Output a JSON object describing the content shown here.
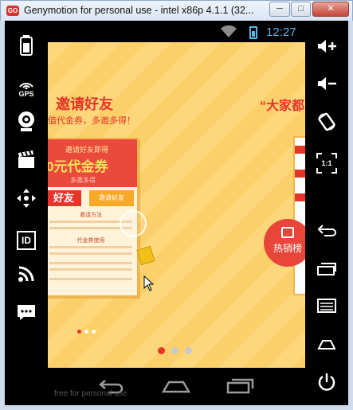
{
  "window": {
    "title": "Genymotion for personal use - intel x86p 4.1.1 (32...",
    "app_icon_text": "GO",
    "minimize_label": "─",
    "maximize_label": "□",
    "close_label": "✕"
  },
  "status_bar": {
    "time": "12:27",
    "accent_color": "#5ab7e6"
  },
  "left_panel": {
    "items": [
      {
        "icon": "battery-icon",
        "label": ""
      },
      {
        "icon": "gps-icon",
        "label": "GPS"
      },
      {
        "icon": "camera-icon",
        "label": ""
      },
      {
        "icon": "clapperboard-icon",
        "label": ""
      },
      {
        "icon": "dpad-icon",
        "label": ""
      },
      {
        "icon": "id-icon",
        "label": "ID"
      },
      {
        "icon": "rss-icon",
        "label": ""
      },
      {
        "icon": "message-icon",
        "label": ""
      }
    ]
  },
  "right_panel": {
    "items": [
      {
        "icon": "volume-up-icon"
      },
      {
        "icon": "volume-down-icon"
      },
      {
        "icon": "rotate-icon"
      },
      {
        "icon": "pixel-perfect-icon",
        "label": "1:1"
      },
      {
        "icon": "back-icon"
      },
      {
        "icon": "recent-apps-icon"
      },
      {
        "icon": "menu-icon"
      },
      {
        "icon": "home-icon"
      },
      {
        "icon": "power-icon"
      }
    ]
  },
  "app": {
    "invite_title": "邀请好友",
    "invite_subtitle": "值代金券，多邀多得！",
    "everyone_title": "“大家都",
    "card": {
      "head_title": "邀请好友即得",
      "voucher": "0元代金券",
      "more": "多邀多得",
      "button_left": "好友",
      "button_right": "邀请好友",
      "section_1": "邀请方法",
      "section_2": "代金券使用"
    },
    "hot_badge": "热销榜",
    "brand_color": "#e5352b",
    "pager_active_index": 0
  },
  "nav_bar": {
    "items": [
      {
        "icon": "back-icon"
      },
      {
        "icon": "home-icon"
      },
      {
        "icon": "recent-apps-icon"
      }
    ]
  },
  "watermark": "free for personal use"
}
